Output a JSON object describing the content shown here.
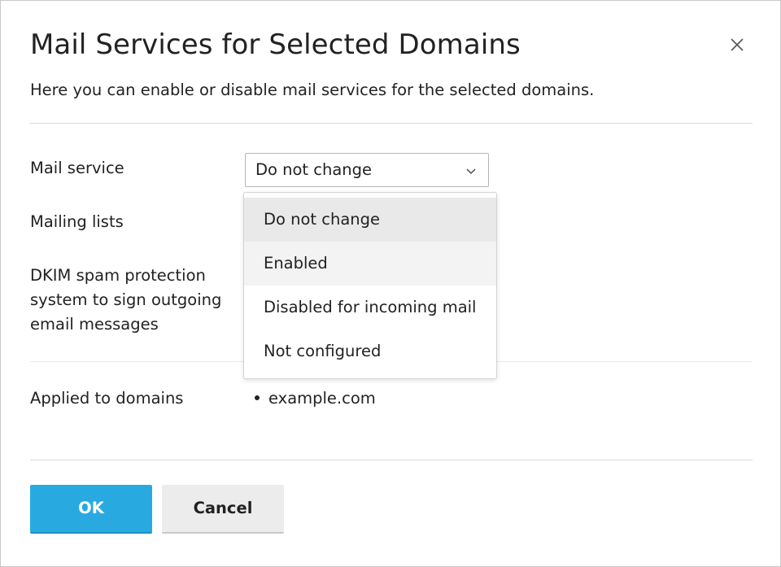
{
  "dialog": {
    "title": "Mail Services for Selected Domains",
    "description": "Here you can enable or disable mail services for the selected domains."
  },
  "fields": {
    "mail_service_label": "Mail service",
    "mailing_lists_label": "Mailing lists",
    "dkim_label": "DKIM spam protection system to sign outgoing email messages",
    "applied_label": "Applied to domains"
  },
  "select": {
    "value": "Do not change",
    "options": [
      "Do not change",
      "Enabled",
      "Disabled for incoming mail",
      "Not configured"
    ]
  },
  "domains": [
    "example.com"
  ],
  "buttons": {
    "ok": "OK",
    "cancel": "Cancel"
  },
  "colors": {
    "primary": "#28aae1",
    "secondary_button": "#ececec"
  },
  "icons": {
    "close": "close-icon",
    "chevron": "chevron-down-icon"
  }
}
